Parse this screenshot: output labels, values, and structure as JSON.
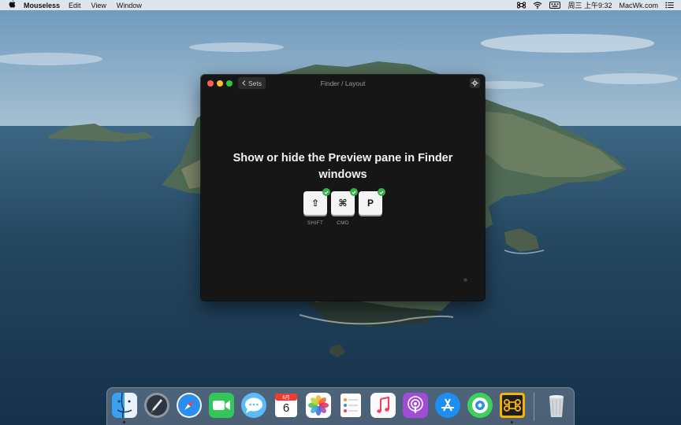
{
  "menubar": {
    "apple_icon": "apple-logo-icon",
    "app_name": "Mouseless",
    "menus": [
      "Edit",
      "View",
      "Window"
    ],
    "clock": "周三 上午9:32",
    "site": "MacWk.com",
    "status_icons": [
      "command-icon",
      "wifi-icon",
      "keyboard-input-icon",
      "list-icon"
    ]
  },
  "window": {
    "back_label": "Sets",
    "title": "Finder / Layout",
    "shortcut_description": "Show or hide the Preview pane in Finder windows",
    "keys": [
      {
        "glyph": "⇧",
        "label": "SHIFT"
      },
      {
        "glyph": "⌘",
        "label": "CMD"
      },
      {
        "glyph": "P",
        "label": ""
      }
    ],
    "next_glyph": "»"
  },
  "dock": {
    "calendar_month": "6月",
    "calendar_day": "6",
    "apps": [
      "Finder",
      "Launchpad",
      "Safari",
      "FaceTime",
      "Messages",
      "Calendar",
      "Photos",
      "Reminders",
      "Music",
      "Podcasts",
      "App Store",
      "Find My",
      "Mouseless",
      "Trash"
    ]
  },
  "colors": {
    "window_bg": "#161616",
    "key_bg": "#f4f4f4",
    "check_green": "#35b24a",
    "close": "#fe5f57",
    "minimize": "#febc2e",
    "maximize": "#28c840"
  }
}
